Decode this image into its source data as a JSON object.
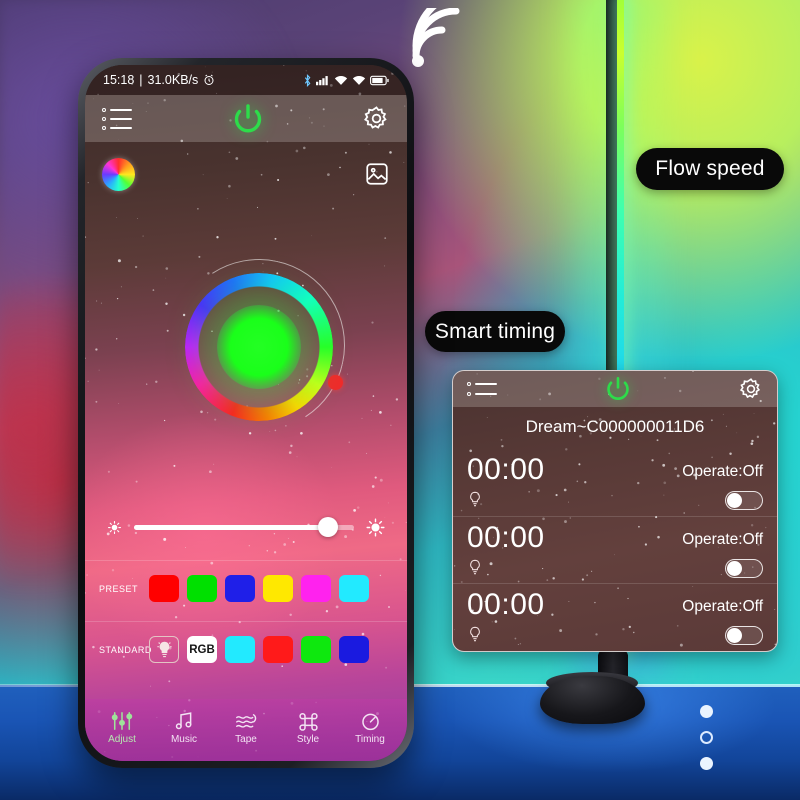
{
  "scene": {
    "callouts": [
      {
        "id": "flow-speed",
        "label": "Flow speed"
      },
      {
        "id": "smart-timing",
        "label": "Smart timing"
      }
    ],
    "wifi_icon": "wifi-icon",
    "lamp": "rgb-corner-floor-lamp",
    "page_dots": [
      "filled",
      "hollow",
      "filled"
    ]
  },
  "phone": {
    "statusbar": {
      "time": "15:18",
      "separator": "|",
      "network_speed": "31.0KB/s",
      "alarm_icon": "alarm-clock-icon",
      "icons": [
        "bluetooth-icon",
        "cellular-signal-icon",
        "wifi-plus-icon",
        "wifi-icon",
        "battery-icon"
      ]
    },
    "appbar": {
      "menu_icon": "list-menu-icon",
      "power_icon": "power-button-icon",
      "settings_icon": "gear-icon"
    },
    "iconrow": {
      "color_wheel_icon": "color-wheel-icon",
      "gallery_icon": "image-picker-icon"
    },
    "colorpicker": {
      "selected_color": "#1aff1a",
      "handle_color": "#ef2b2b",
      "ring_name": "hue-ring",
      "arc_name": "flow-speed-arc"
    },
    "brightness": {
      "low_icon": "brightness-low-icon",
      "high_icon": "brightness-high-icon",
      "value": 88
    },
    "preset": {
      "label": "PRESET",
      "colors": [
        "#ff0000",
        "#00e000",
        "#1f1fe8",
        "#ffe800",
        "#ff22ee",
        "#22eaff"
      ]
    },
    "standard": {
      "label": "STANDARD",
      "bulb_icon": "light-bulb-icon",
      "rgb_label": "RGB",
      "colors": [
        "#22eaff",
        "#ff1a1a",
        "#0ee80e",
        "#1a1ae0"
      ]
    },
    "nav": [
      {
        "label": "Adjust",
        "icon": "sliders-icon",
        "active": true
      },
      {
        "label": "Music",
        "icon": "music-note-icon",
        "active": false
      },
      {
        "label": "Tape",
        "icon": "waves-icon",
        "active": false
      },
      {
        "label": "Style",
        "icon": "command-icon",
        "active": false
      },
      {
        "label": "Timing",
        "icon": "stopwatch-icon",
        "active": false
      }
    ]
  },
  "timing_panel": {
    "menu_icon": "list-menu-icon",
    "power_icon": "power-button-icon",
    "settings_icon": "gear-icon",
    "device_name": "Dream~C000000011D6",
    "rows": [
      {
        "time": "00:00",
        "operate": "Operate:Off",
        "bulb_icon": "light-bulb-icon",
        "toggle": "off"
      },
      {
        "time": "00:00",
        "operate": "Operate:Off",
        "bulb_icon": "light-bulb-icon",
        "toggle": "off"
      },
      {
        "time": "00:00",
        "operate": "Operate:Off",
        "bulb_icon": "light-bulb-icon",
        "toggle": "off"
      }
    ]
  }
}
